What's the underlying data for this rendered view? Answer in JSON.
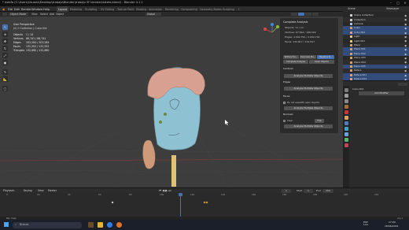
{
  "titlebar": {
    "title": "* estefa (C:\\Users\\Usuario\\Desktop\\trabajo\\Blender\\trabajo 3F blender\\estefa.blend) - Blender 4.1.1"
  },
  "menubar": {
    "menus": [
      "File",
      "Edit",
      "Render",
      "Window",
      "Help"
    ],
    "workspaces": [
      "Layout",
      "Modeling",
      "Sculpting",
      "UV Editing",
      "Texture Paint",
      "Shading",
      "Animation",
      "Rendering",
      "Compositing",
      "Geometry Nodes",
      "Scripting"
    ],
    "active_workspace": "Layout"
  },
  "viewport_header": {
    "mode": "Object Mode",
    "menus": [
      "View",
      "Select",
      "Add",
      "Object"
    ],
    "transform": "Global"
  },
  "viewport_overlay": {
    "line1": "User Perspective",
    "line2": "(0) 0 Collection | Cubo.004",
    "stats": [
      {
        "label": "Objects",
        "value": "1 / 14"
      },
      {
        "label": "Vertices",
        "value": "66,741 / 66,741"
      },
      {
        "label": "Edges",
        "value": "203,284 / 203,284"
      },
      {
        "label": "Faces",
        "value": "132,552 / 132,552"
      },
      {
        "label": "Triangles",
        "value": "132,660 / 132,660"
      }
    ]
  },
  "npanel": {
    "header": "Complete Analysis",
    "lines": [
      "Objects: 11 / 11",
      "Vertices: 67,644 / 166,592",
      "Edges: 2,092,792 / 2,092,792",
      "Faces: 132,817 / 132,817"
    ],
    "buttons_row": [
      "Without Su...",
      "Overview Ma...",
      "Negative B..."
    ],
    "buttons_row2": [
      "Complete Analysis",
      "Open Objects"
    ],
    "sections": [
      {
        "title": "Cardinal",
        "button": "Analyze Multiple Objects"
      },
      {
        "title": "Edges",
        "button": "Analyze Multiple Objects"
      },
      {
        "title": "Faces",
        "option": "Do not use/with open objects",
        "button": "Analyze Multiple Objects"
      },
      {
        "title": "Normals",
        "toggle_a": "Clear",
        "toggle_b": "Flip",
        "button": "Analyze Multiple Objects"
      }
    ]
  },
  "outliner": {
    "title": "Scene",
    "view_layer": "ViewLayer",
    "items": [
      {
        "name": "Scene Collection",
        "color": "#cfcfcf",
        "sel": false
      },
      {
        "name": "Collection",
        "color": "#cfcfcf",
        "sel": false
      },
      {
        "name": "Camera",
        "color": "#a8c8ff",
        "sel": false
      },
      {
        "name": "Cubo",
        "color": "#e0a060",
        "sel": true
      },
      {
        "name": "Cubo.001",
        "color": "#e0a060",
        "sel": true
      },
      {
        "name": "Light",
        "color": "#e8d070",
        "sel": false
      },
      {
        "name": "Light.001",
        "color": "#e8d070",
        "sel": false
      },
      {
        "name": "Plano",
        "color": "#e0a060",
        "sel": false
      },
      {
        "name": "Plano.001",
        "color": "#e0a060",
        "sel": true
      },
      {
        "name": "Plano.002",
        "color": "#e0a060",
        "sel": true
      },
      {
        "name": "Plano.003",
        "color": "#e0a060",
        "sel": false
      },
      {
        "name": "Plano.004",
        "color": "#e0a060",
        "sel": false
      },
      {
        "name": "Plano.005",
        "color": "#e0a060",
        "sel": true
      },
      {
        "name": "Esfera",
        "color": "#e0a060",
        "sel": false
      },
      {
        "name": "Esfera.001",
        "color": "#e0a060",
        "sel": true
      },
      {
        "name": "Esfera.002",
        "color": "#e0a060",
        "sel": true
      }
    ]
  },
  "properties": {
    "object_name": "Cubo.004",
    "add_modifier": "Add Modifier"
  },
  "timeline": {
    "menus": [
      "Playback",
      "Keying",
      "View",
      "Marker"
    ],
    "current_frame": "1",
    "start_label": "Start",
    "start": "1",
    "end_label": "End",
    "end": "250",
    "ticks": [
      "0",
      "20",
      "40",
      "60",
      "80",
      "100",
      "120",
      "140",
      "160",
      "180",
      "200",
      "220",
      "240"
    ]
  },
  "statusbar": {
    "left": "Pan View",
    "right": "4.1.1"
  },
  "taskbar": {
    "search_placeholder": "Buscar",
    "lang": "ESP LAA",
    "time": "17:09",
    "date": "18/06/2024"
  }
}
